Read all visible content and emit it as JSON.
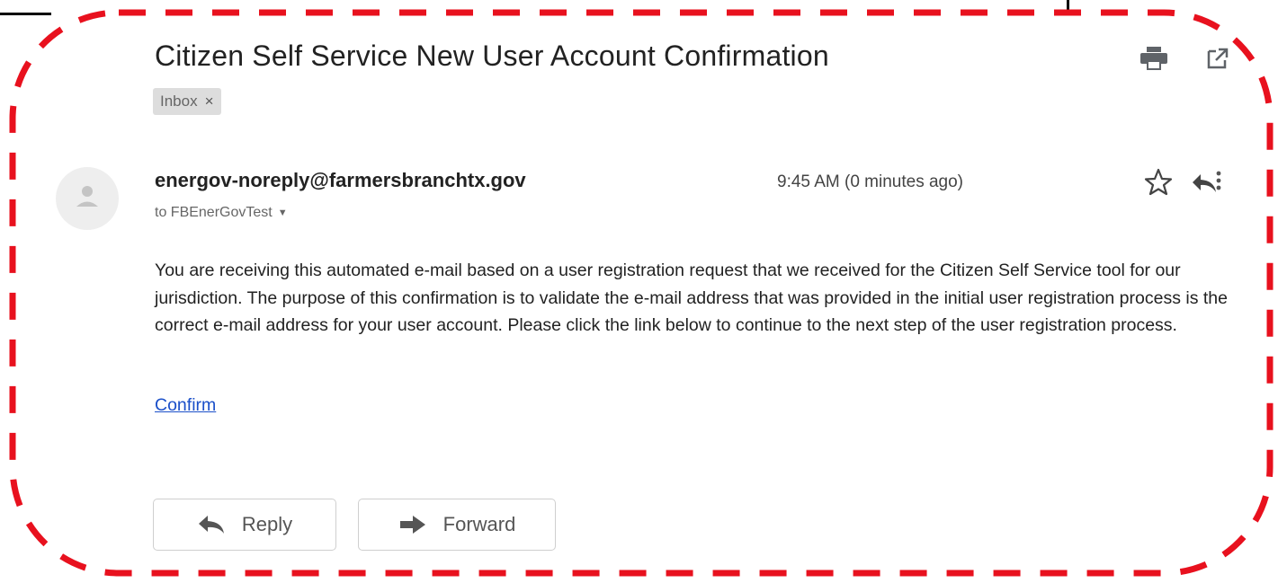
{
  "email": {
    "subject": "Citizen Self Service New User Account Confirmation",
    "label": "Inbox",
    "label_close": "×",
    "sender": "energov-noreply@farmersbranchtx.gov",
    "recipient": "to FBEnerGovTest",
    "timestamp": "9:45 AM (0 minutes ago)",
    "body": "You are receiving this automated e-mail based on a user registration request that we received for the Citizen Self Service tool for our jurisdiction. The purpose of this confirmation is to validate the e-mail address that was provided in the initial user registration process is the correct e-mail address for your user account. Please click the link below to continue to the next step of the user registration process.",
    "link_text": "Confirm"
  },
  "actions": {
    "reply_label": "Reply",
    "forward_label": "Forward"
  },
  "icons": {
    "print": "print-icon",
    "popout": "open-in-new-window-icon",
    "star": "star-icon",
    "reply": "reply-icon",
    "more": "more-options-icon",
    "forward": "forward-icon",
    "avatar": "avatar-icon",
    "dropdown": "chevron-down-icon"
  },
  "colors": {
    "highlight_border": "#e8111e",
    "link": "#1a4fc9",
    "chip_bg": "#dddddd",
    "icon": "#5f6368"
  }
}
